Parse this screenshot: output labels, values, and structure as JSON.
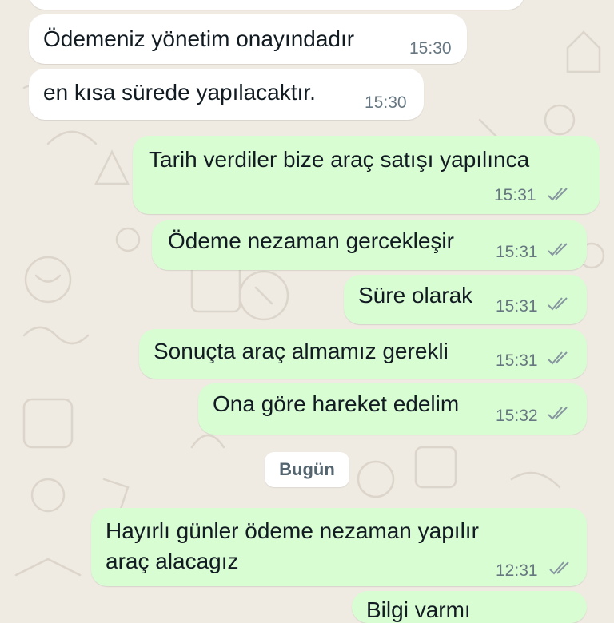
{
  "chat": {
    "messages": [
      {
        "text": "Ödemeniz yönetim onayındadır",
        "time": "15:30",
        "direction": "incoming"
      },
      {
        "text": "en kısa sürede yapılacaktır.",
        "time": "15:30",
        "direction": "incoming"
      },
      {
        "text": "Tarih verdiler bize araç satışı yapılınca",
        "time": "15:31",
        "direction": "outgoing",
        "status": "read-ticks-icon"
      },
      {
        "text": "Ödeme nezaman gercekleşir",
        "time": "15:31",
        "direction": "outgoing",
        "status": "read-ticks-icon"
      },
      {
        "text": "Süre olarak",
        "time": "15:31",
        "direction": "outgoing",
        "status": "read-ticks-icon"
      },
      {
        "text": "Sonuçta araç almamız gerekli",
        "time": "15:31",
        "direction": "outgoing",
        "status": "read-ticks-icon"
      },
      {
        "text": "Ona göre hareket edelim",
        "time": "15:32",
        "direction": "outgoing",
        "status": "read-ticks-icon"
      },
      {
        "text_lines": [
          "Hayırlı günler ödeme nezaman yapılır",
          "araç alacagız"
        ],
        "time": "12:31",
        "direction": "outgoing",
        "status": "read-ticks-icon"
      },
      {
        "text": "Bilgi varmı",
        "direction": "outgoing"
      }
    ],
    "day_divider": "Bugün"
  },
  "colors": {
    "background": "#efeae2",
    "incoming_bubble": "#ffffff",
    "outgoing_bubble": "#d9fdd3",
    "timestamp": "#667781",
    "tick": "#8696a0"
  }
}
